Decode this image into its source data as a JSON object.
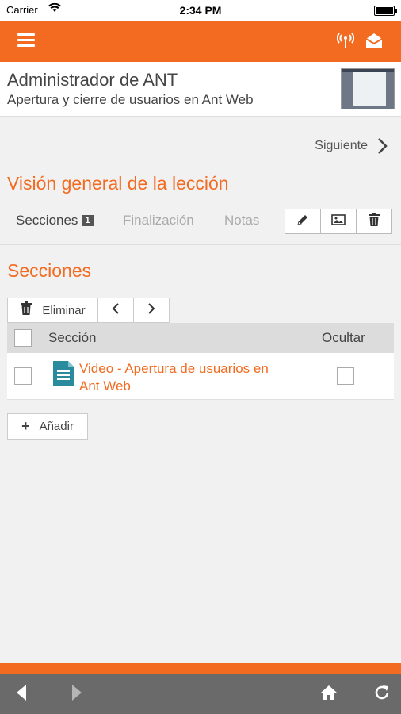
{
  "status_bar": {
    "carrier": "Carrier",
    "time": "2:34 PM"
  },
  "header": {
    "title": "Administrador de ANT",
    "subtitle": "Apertura y cierre de usuarios en Ant Web"
  },
  "navigation": {
    "next_label": "Siguiente"
  },
  "overview": {
    "title": "Visión general de la lección"
  },
  "tabs": [
    {
      "label": "Secciones",
      "badge": "1",
      "active": true
    },
    {
      "label": "Finalización",
      "active": false
    },
    {
      "label": "Notas",
      "active": false
    }
  ],
  "sections": {
    "title": "Secciones",
    "delete_label": "Eliminar",
    "columns": {
      "section": "Sección",
      "hide": "Ocultar"
    },
    "rows": [
      {
        "title": "Video - Apertura de usuarios en Ant Web",
        "hidden": false
      }
    ],
    "add_label": "Añadir"
  },
  "icons": {
    "menu": "hamburger-icon",
    "broadcast": "broadcast-icon",
    "mail": "mail-icon",
    "edit": "pencil-icon",
    "image": "image-icon",
    "delete": "trash-icon",
    "document": "document-icon",
    "back": "back-arrow-icon",
    "forward": "forward-arrow-icon",
    "home": "home-icon",
    "refresh": "refresh-icon"
  },
  "colors": {
    "accent": "#f26b21",
    "toolbar": "#6a6a6a",
    "background": "#f1f1f1"
  }
}
